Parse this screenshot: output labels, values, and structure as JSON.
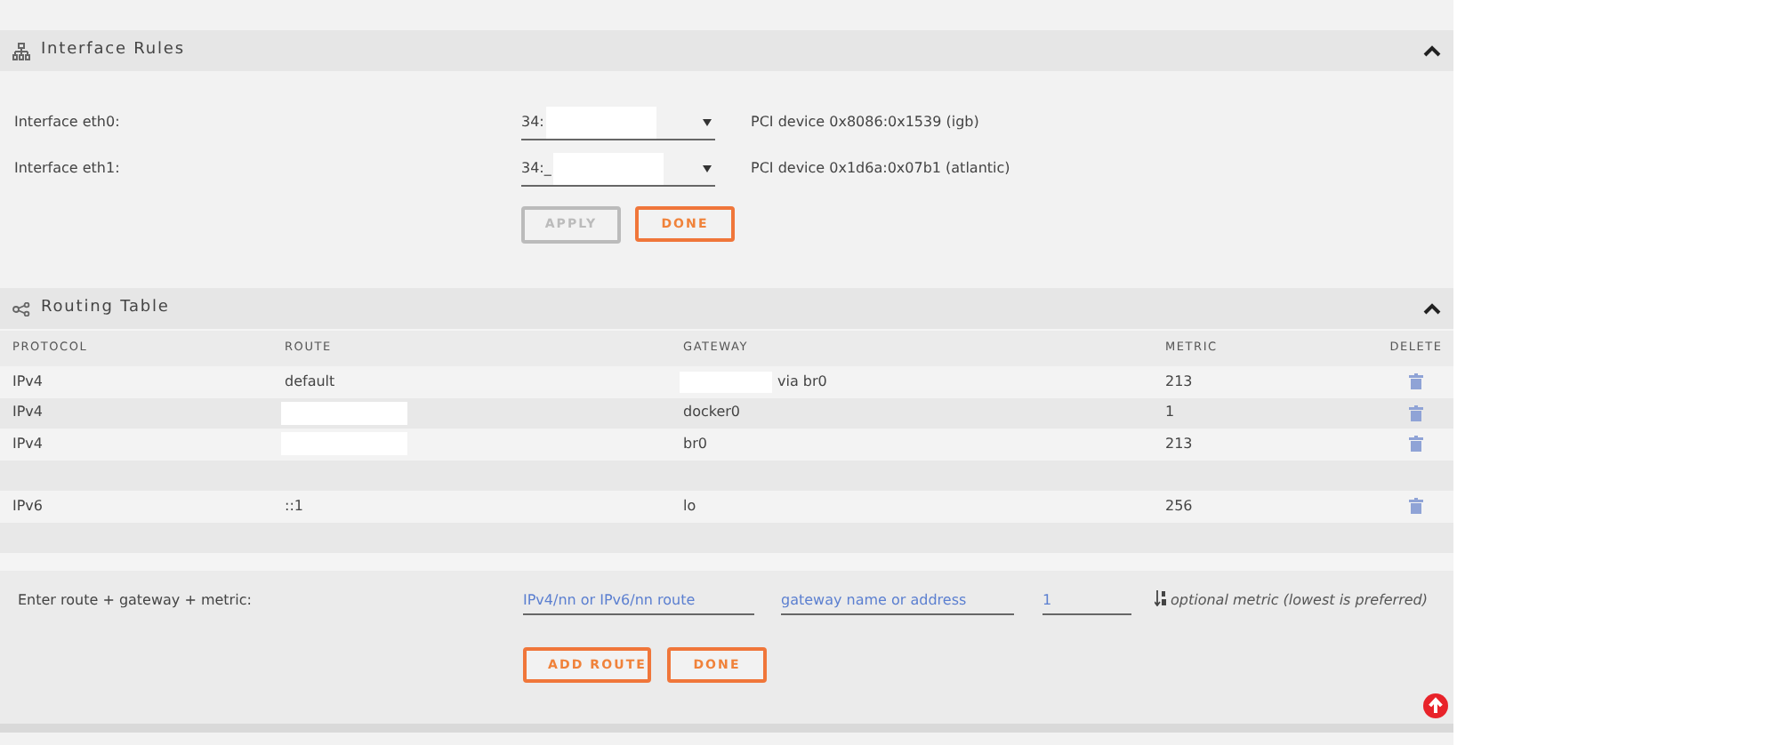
{
  "interface_rules": {
    "title": "Interface Rules",
    "interfaces": [
      {
        "label": "Interface eth0:",
        "value": "34:",
        "redacted": true,
        "device": "PCI device 0x8086:0x1539 (igb)"
      },
      {
        "label": "Interface eth1:",
        "value": "34:_",
        "redacted": true,
        "device": "PCI device 0x1d6a:0x07b1 (atlantic)"
      }
    ],
    "buttons": [
      {
        "label": "APPLY",
        "disabled": true
      },
      {
        "label": "DONE",
        "disabled": false
      }
    ]
  },
  "routing_table": {
    "title": "Routing Table",
    "columns": [
      "PROTOCOL",
      "ROUTE",
      "GATEWAY",
      "METRIC",
      "DELETE"
    ],
    "rows": [
      {
        "kind": "route",
        "protocol": "IPv4",
        "route": "default",
        "route_redacted": false,
        "gateway": "via br0",
        "gateway_redacted": true,
        "metric": "213"
      },
      {
        "kind": "route",
        "protocol": "IPv4",
        "route": "",
        "route_redacted": true,
        "gateway": "docker0",
        "gateway_redacted": false,
        "metric": "1"
      },
      {
        "kind": "route",
        "protocol": "IPv4",
        "route": "",
        "route_redacted": true,
        "gateway": "br0",
        "gateway_redacted": false,
        "metric": "213"
      },
      {
        "kind": "blank"
      },
      {
        "kind": "route",
        "protocol": "IPv6",
        "route": "::1",
        "route_redacted": false,
        "gateway": "lo",
        "gateway_redacted": false,
        "metric": "256"
      },
      {
        "kind": "blank"
      }
    ],
    "add_form": {
      "label": "Enter route + gateway + metric:",
      "route_placeholder": "IPv4/nn or IPv6/nn route",
      "gateway_placeholder": "gateway name or address",
      "metric_value": "1",
      "metric_hint": "optional metric (lowest is preferred)",
      "buttons": [
        {
          "label": "ADD ROUTE"
        },
        {
          "label": "DONE"
        }
      ]
    }
  }
}
